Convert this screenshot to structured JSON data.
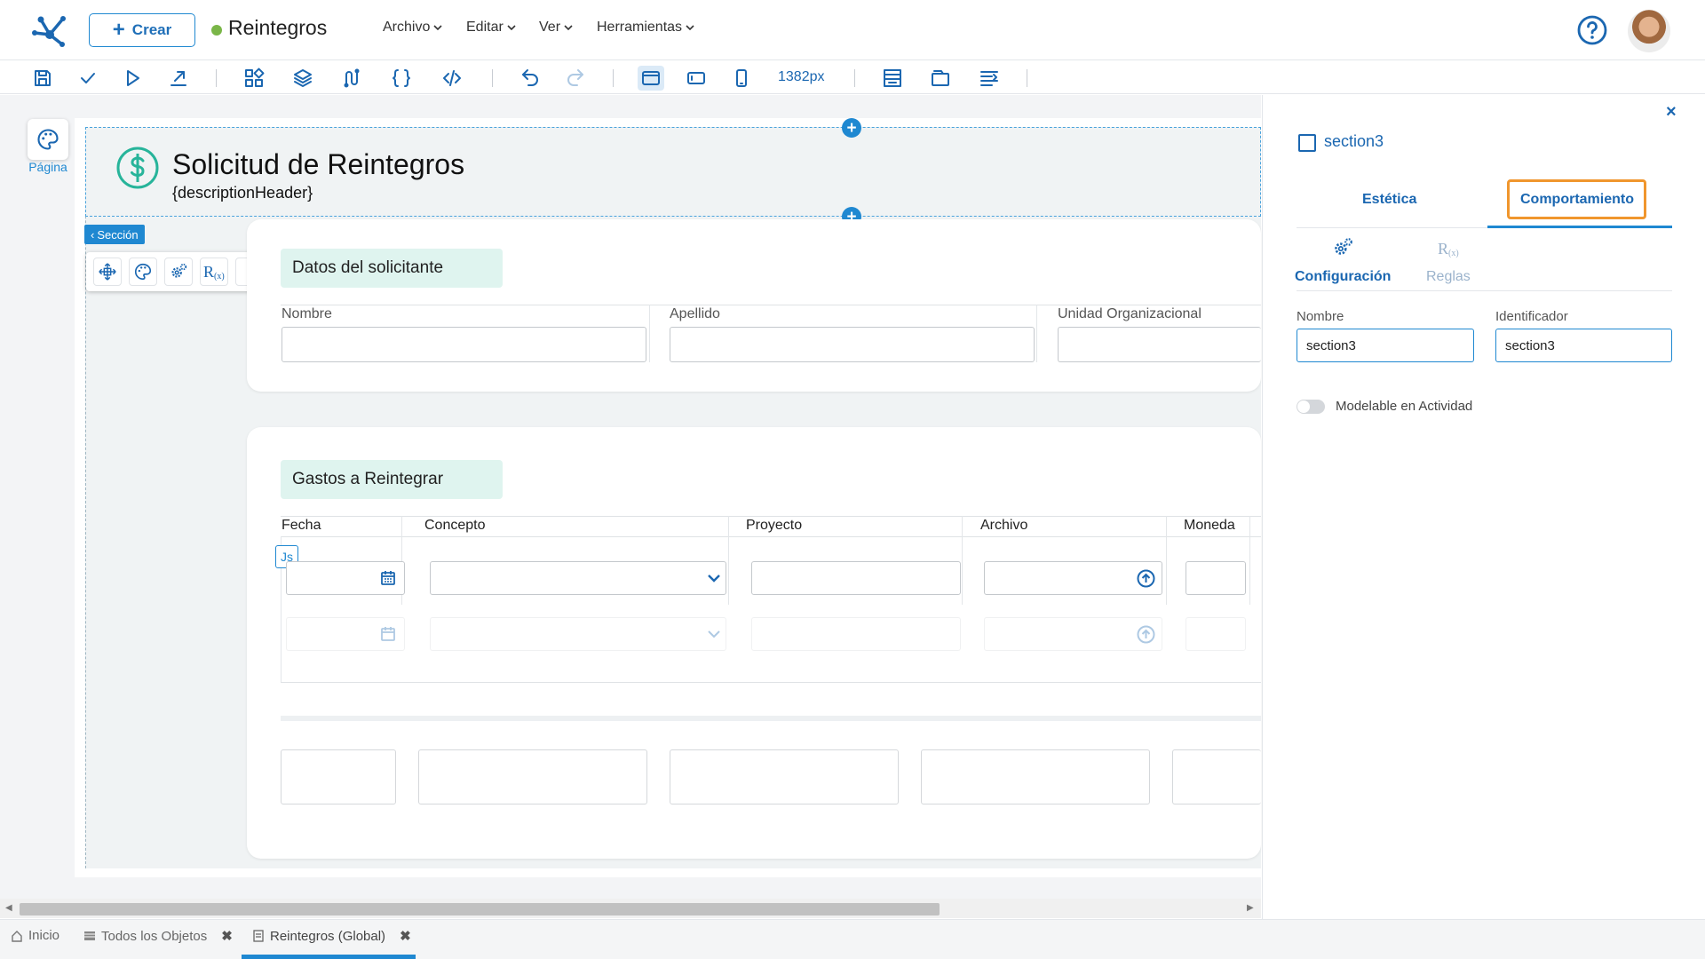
{
  "header": {
    "create_label": "Crear",
    "app_title": "Reintegros",
    "menus": [
      "Archivo",
      "Editar",
      "Ver",
      "Herramientas"
    ]
  },
  "toolbar": {
    "width_label": "1382px",
    "icons": [
      "save-icon",
      "check-icon",
      "play-icon",
      "export-icon",
      "components-icon",
      "layers-icon",
      "variables-icon",
      "braces-icon",
      "code-icon",
      "undo-icon",
      "redo-icon",
      "desktop-view-icon",
      "tablet-view-icon",
      "mobile-view-icon",
      "grid-layout-icon",
      "panel-icon",
      "align-icon"
    ]
  },
  "sidebar": {
    "page_label": "Página"
  },
  "form": {
    "title": "Solicitud de Reintegros",
    "description": "{descriptionHeader}",
    "section_tag": "Sección",
    "section1": {
      "title": "Datos del solicitante",
      "fields": [
        "Nombre",
        "Apellido",
        "Unidad Organizacional"
      ]
    },
    "section2": {
      "title": "Gastos a Reintegrar",
      "columns": [
        "Fecha",
        "Concepto",
        "Proyecto",
        "Archivo",
        "Moneda"
      ],
      "js_chip": "Js"
    }
  },
  "panel": {
    "section_name": "section3",
    "tabs": [
      "Estética",
      "Comportamiento"
    ],
    "subtabs": [
      "Configuración",
      "Reglas"
    ],
    "nombre_label": "Nombre",
    "nombre_value": "section3",
    "identificador_label": "Identificador",
    "identificador_value": "section3",
    "toggle_label": "Modelable en Actividad"
  },
  "bottom_tabs": [
    {
      "label": "Inicio"
    },
    {
      "label": "Todos los Objetos"
    },
    {
      "label": "Reintegros (Global)"
    }
  ],
  "colors": {
    "accent": "#1f88d1",
    "highlight": "#f0962d",
    "section_title_bg": "#dff4ef"
  }
}
